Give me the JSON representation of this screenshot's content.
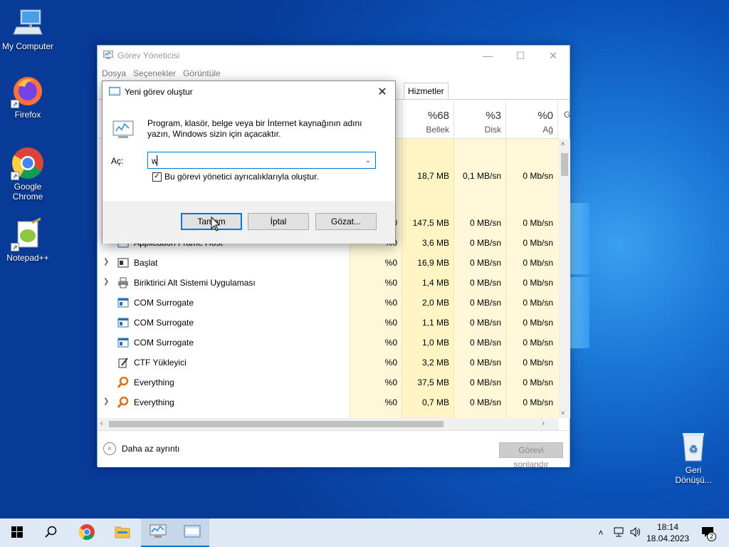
{
  "desktop": {
    "icons": [
      {
        "label": "My Computer",
        "icon": "computer-icon"
      },
      {
        "label": "Firefox",
        "icon": "firefox-icon"
      },
      {
        "label": "Google Chrome",
        "icon": "chrome-icon"
      },
      {
        "label": "Notepad++",
        "icon": "notepadpp-icon"
      },
      {
        "label": "Geri Dönüşü...",
        "icon": "recycle-bin-icon"
      }
    ]
  },
  "task_manager": {
    "title": "Görev Yöneticisi",
    "menu": [
      "Dosya",
      "Seçenekler",
      "Görüntüle"
    ],
    "tab_partial": "r",
    "tab_services": "Hizmetler",
    "columns": [
      {
        "pct": "%68",
        "label": "Bellek"
      },
      {
        "pct": "%3",
        "label": "Disk"
      },
      {
        "pct": "%0",
        "label": "Ağ"
      },
      {
        "pct": "",
        "label": "G"
      }
    ],
    "rows": [
      {
        "name": "",
        "cpu": "",
        "mem": "18,7 MB",
        "disk": "0,1 MB/sn",
        "net": "0 Mb/sn"
      },
      {
        "name": "",
        "cpu": "%0",
        "mem": "147,5 MB",
        "disk": "0 MB/sn",
        "net": "0 Mb/sn"
      },
      {
        "name": "Application Frame Host",
        "cpu": "%0",
        "mem": "3,6 MB",
        "disk": "0 MB/sn",
        "net": "0 Mb/sn"
      },
      {
        "name": "Başlat",
        "cpu": "%0",
        "mem": "16,9 MB",
        "disk": "0 MB/sn",
        "net": "0 Mb/sn"
      },
      {
        "name": "Biriktirici Alt Sistemi Uygulaması",
        "cpu": "%0",
        "mem": "1,4 MB",
        "disk": "0 MB/sn",
        "net": "0 Mb/sn"
      },
      {
        "name": "COM Surrogate",
        "cpu": "%0",
        "mem": "2,0 MB",
        "disk": "0 MB/sn",
        "net": "0 Mb/sn"
      },
      {
        "name": "COM Surrogate",
        "cpu": "%0",
        "mem": "1,1 MB",
        "disk": "0 MB/sn",
        "net": "0 Mb/sn"
      },
      {
        "name": "COM Surrogate",
        "cpu": "%0",
        "mem": "1,0 MB",
        "disk": "0 MB/sn",
        "net": "0 Mb/sn"
      },
      {
        "name": "CTF Yükleyici",
        "cpu": "%0",
        "mem": "3,2 MB",
        "disk": "0 MB/sn",
        "net": "0 Mb/sn"
      },
      {
        "name": "Everything",
        "cpu": "%0",
        "mem": "37,5 MB",
        "disk": "0 MB/sn",
        "net": "0 Mb/sn"
      },
      {
        "name": "Everything",
        "cpu": "%0",
        "mem": "0,7 MB",
        "disk": "0 MB/sn",
        "net": "0 Mb/sn"
      }
    ],
    "less_details": "Daha az ayrıntı",
    "end_task": "Görevi sonlandır"
  },
  "run_dialog": {
    "title": "Yeni görev oluştur",
    "description": "Program, klasör, belge veya bir İnternet kaynağının adını yazın, Windows sizin için açacaktır.",
    "open_label": "Aç:",
    "input_value": "w",
    "admin_checkbox_label": "Bu görevi yönetici ayrıcalıklarıyla oluştur.",
    "admin_checked": true,
    "ok_label": "Tamam",
    "cancel_label": "İptal",
    "browse_label": "Gözat..."
  },
  "taskbar": {
    "time": "18:14",
    "date": "18.04.2023",
    "notification_count": "2"
  },
  "colors": {
    "accent": "#0078d7",
    "highlight_column": "#fff4c4"
  }
}
